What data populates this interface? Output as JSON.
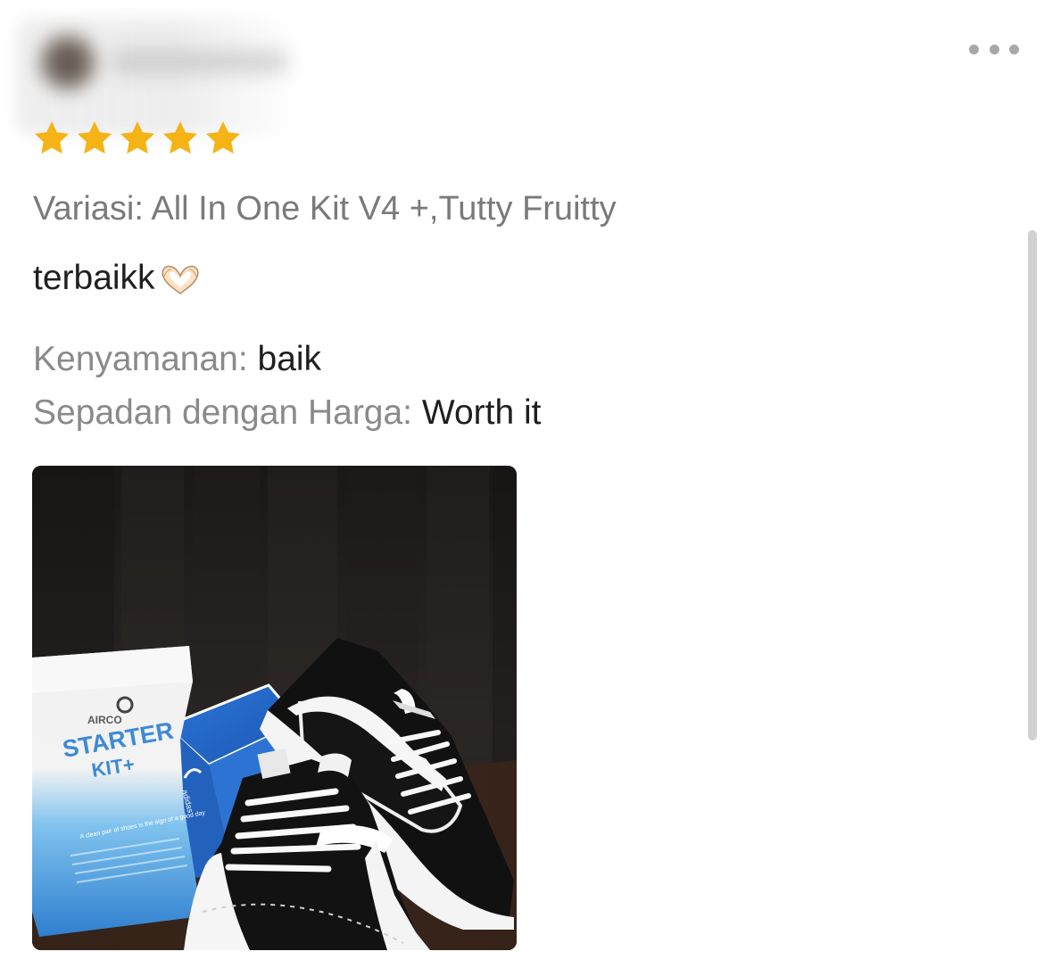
{
  "review": {
    "rating": 5,
    "rating_max": 5,
    "variation_label": "Variasi: All In One Kit V4 +,Tutty Fruitty",
    "comment": "terbaikk",
    "attributes": [
      {
        "key": "Kenyamanan:",
        "value": "baik"
      },
      {
        "key": "Sepadan dengan Harga:",
        "value": "Worth it"
      }
    ]
  },
  "photo": {
    "bag_logo": "AIRCO",
    "bag_title_1": "STARTER",
    "bag_title_2": "KIT+",
    "bag_tagline": "A clean pair of shoes is the sign of a good day"
  },
  "icons": {
    "more_menu": "more-dots-icon",
    "star": "star-icon",
    "emoji": "heart-hands-icon"
  },
  "colors": {
    "star": "#f6b316",
    "muted_text": "#7a7a7a",
    "primary_text": "#1f1f1f",
    "scrollbar": "#d1d1d1"
  }
}
